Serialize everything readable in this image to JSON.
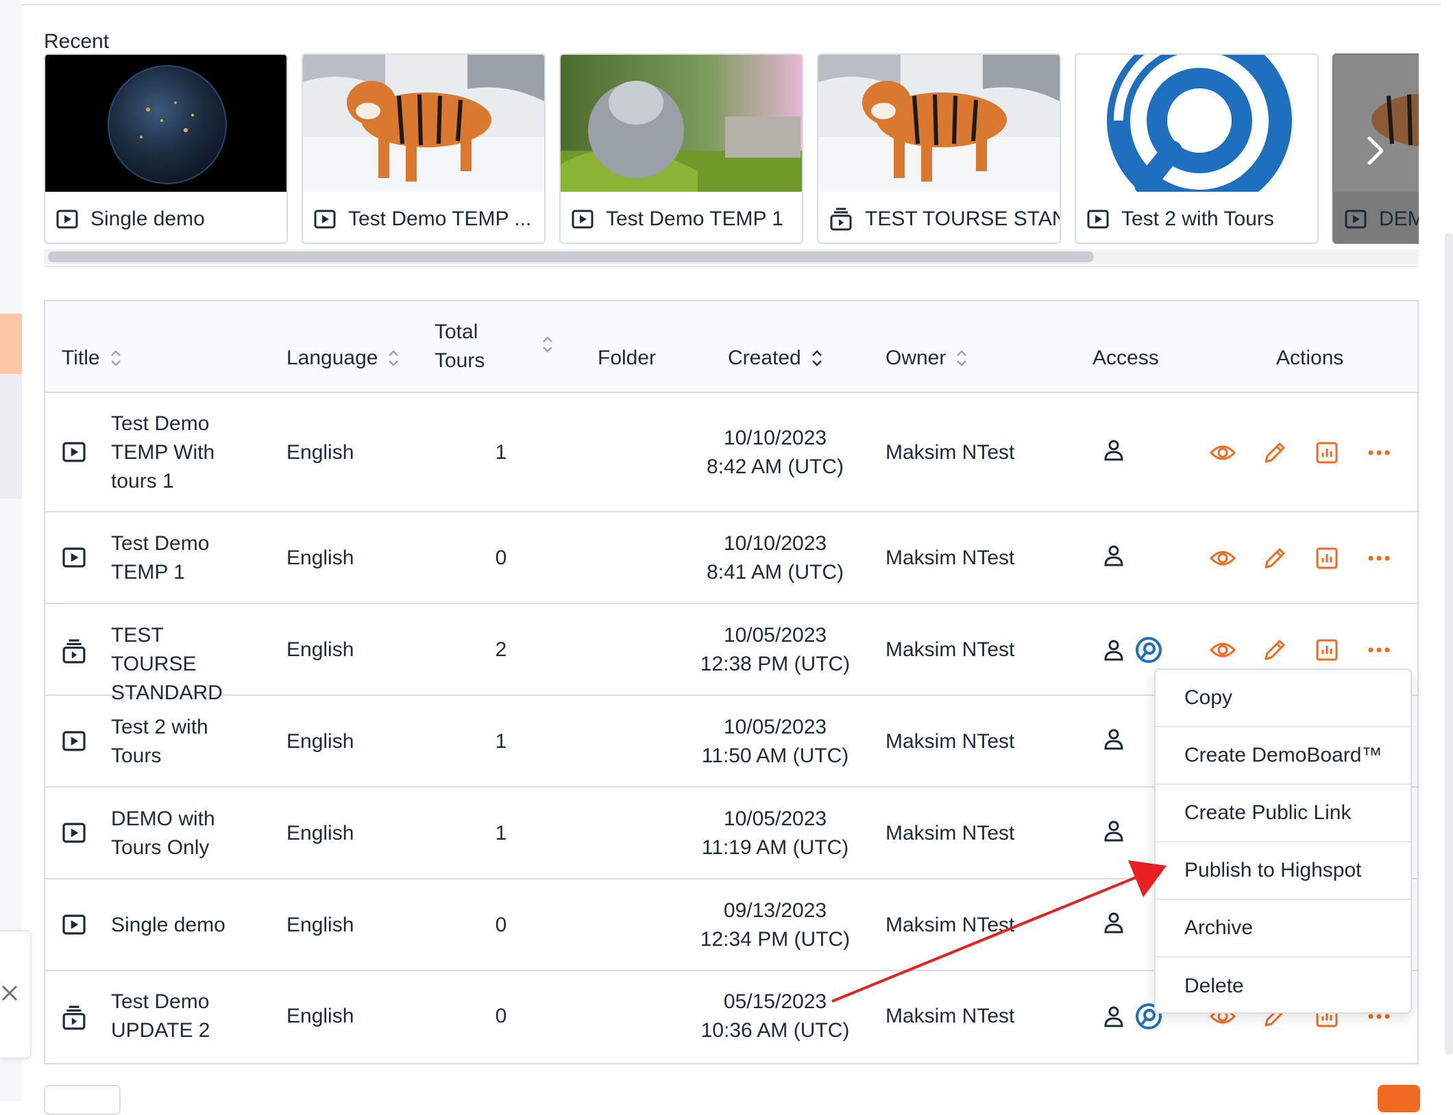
{
  "recent": {
    "heading": "Recent",
    "cards": [
      {
        "label": "Single demo",
        "type": "demo"
      },
      {
        "label": "Test Demo TEMP ...",
        "type": "demo"
      },
      {
        "label": "Test Demo TEMP 1",
        "type": "demo"
      },
      {
        "label": "TEST TOURSE STAN...",
        "type": "tour"
      },
      {
        "label": "Test 2 with Tours",
        "type": "demo"
      },
      {
        "label": "DEM",
        "type": "demo"
      }
    ]
  },
  "table": {
    "columns": {
      "title": "Title",
      "language": "Language",
      "total_tours_1": "Total",
      "total_tours_2": "Tours",
      "folder": "Folder",
      "created": "Created",
      "owner": "Owner",
      "access": "Access",
      "actions": "Actions"
    },
    "rows": [
      {
        "title_lines": [
          "Test Demo",
          "TEMP With",
          "tours 1"
        ],
        "type": "demo",
        "language": "English",
        "tours": "1",
        "date": "10/10/2023",
        "time": "8:42 AM (UTC)",
        "owner": "Maksim NTest",
        "highspot": false
      },
      {
        "title_lines": [
          "Test Demo",
          "TEMP 1"
        ],
        "type": "demo",
        "language": "English",
        "tours": "0",
        "date": "10/10/2023",
        "time": "8:41 AM (UTC)",
        "owner": "Maksim NTest",
        "highspot": false
      },
      {
        "title_lines": [
          "TEST TOURSE",
          "STANDARD"
        ],
        "type": "tour",
        "language": "English",
        "tours": "2",
        "date": "10/05/2023",
        "time": "12:38 PM (UTC)",
        "owner": "Maksim NTest",
        "highspot": true
      },
      {
        "title_lines": [
          "Test 2 with",
          "Tours"
        ],
        "type": "demo",
        "language": "English",
        "tours": "1",
        "date": "10/05/2023",
        "time": "11:50 AM (UTC)",
        "owner": "Maksim NTest",
        "highspot": false
      },
      {
        "title_lines": [
          "DEMO with",
          "Tours Only"
        ],
        "type": "demo",
        "language": "English",
        "tours": "1",
        "date": "10/05/2023",
        "time": "11:19 AM (UTC)",
        "owner": "Maksim NTest",
        "highspot": false
      },
      {
        "title_lines": [
          "Single demo"
        ],
        "type": "demo",
        "language": "English",
        "tours": "0",
        "date": "09/13/2023",
        "time": "12:34 PM (UTC)",
        "owner": "Maksim NTest",
        "highspot": false
      },
      {
        "title_lines": [
          "Test Demo",
          "UPDATE 2"
        ],
        "type": "tour",
        "language": "English",
        "tours": "0",
        "date": "05/15/2023",
        "time": "10:36 AM (UTC)",
        "owner": "Maksim NTest",
        "highspot": true
      }
    ]
  },
  "menu": {
    "items": [
      "Copy",
      "Create DemoBoard™",
      "Create Public Link",
      "Publish to Highspot",
      "Archive",
      "Delete"
    ]
  },
  "colors": {
    "accent": "#f06a1f",
    "highspot": "#1f6fbf",
    "arrow": "#e8201f",
    "border": "#d9dce1"
  }
}
